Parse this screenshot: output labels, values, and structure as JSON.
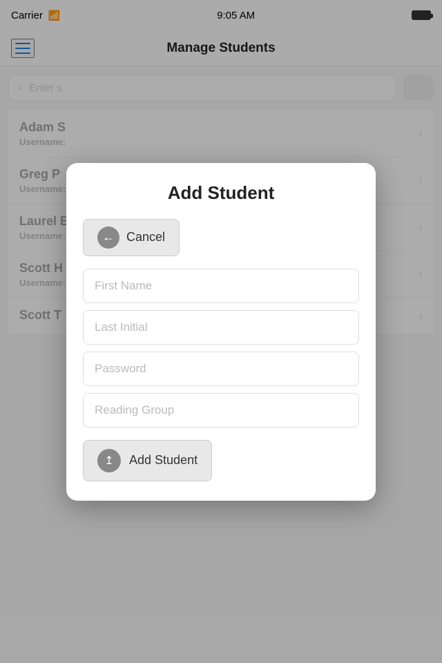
{
  "statusBar": {
    "carrier": "Carrier",
    "time": "9:05 AM"
  },
  "navBar": {
    "title": "Manage Students",
    "hamburgerLabel": "Menu"
  },
  "search": {
    "placeholder": "Enter s"
  },
  "students": [
    {
      "name": "Adam S",
      "username": "Username:"
    },
    {
      "name": "Greg P",
      "username": "Username:"
    },
    {
      "name": "Laurel B",
      "username": "Username:"
    },
    {
      "name": "Scott H",
      "username": "Username:"
    },
    {
      "name": "Scott T",
      "username": ""
    }
  ],
  "modal": {
    "title": "Add Student",
    "cancelLabel": "Cancel",
    "firstNamePlaceholder": "First Name",
    "lastInitialPlaceholder": "Last Initial",
    "passwordPlaceholder": "Password",
    "readingGroupPlaceholder": "Reading Group",
    "addStudentLabel": "Add Student"
  }
}
